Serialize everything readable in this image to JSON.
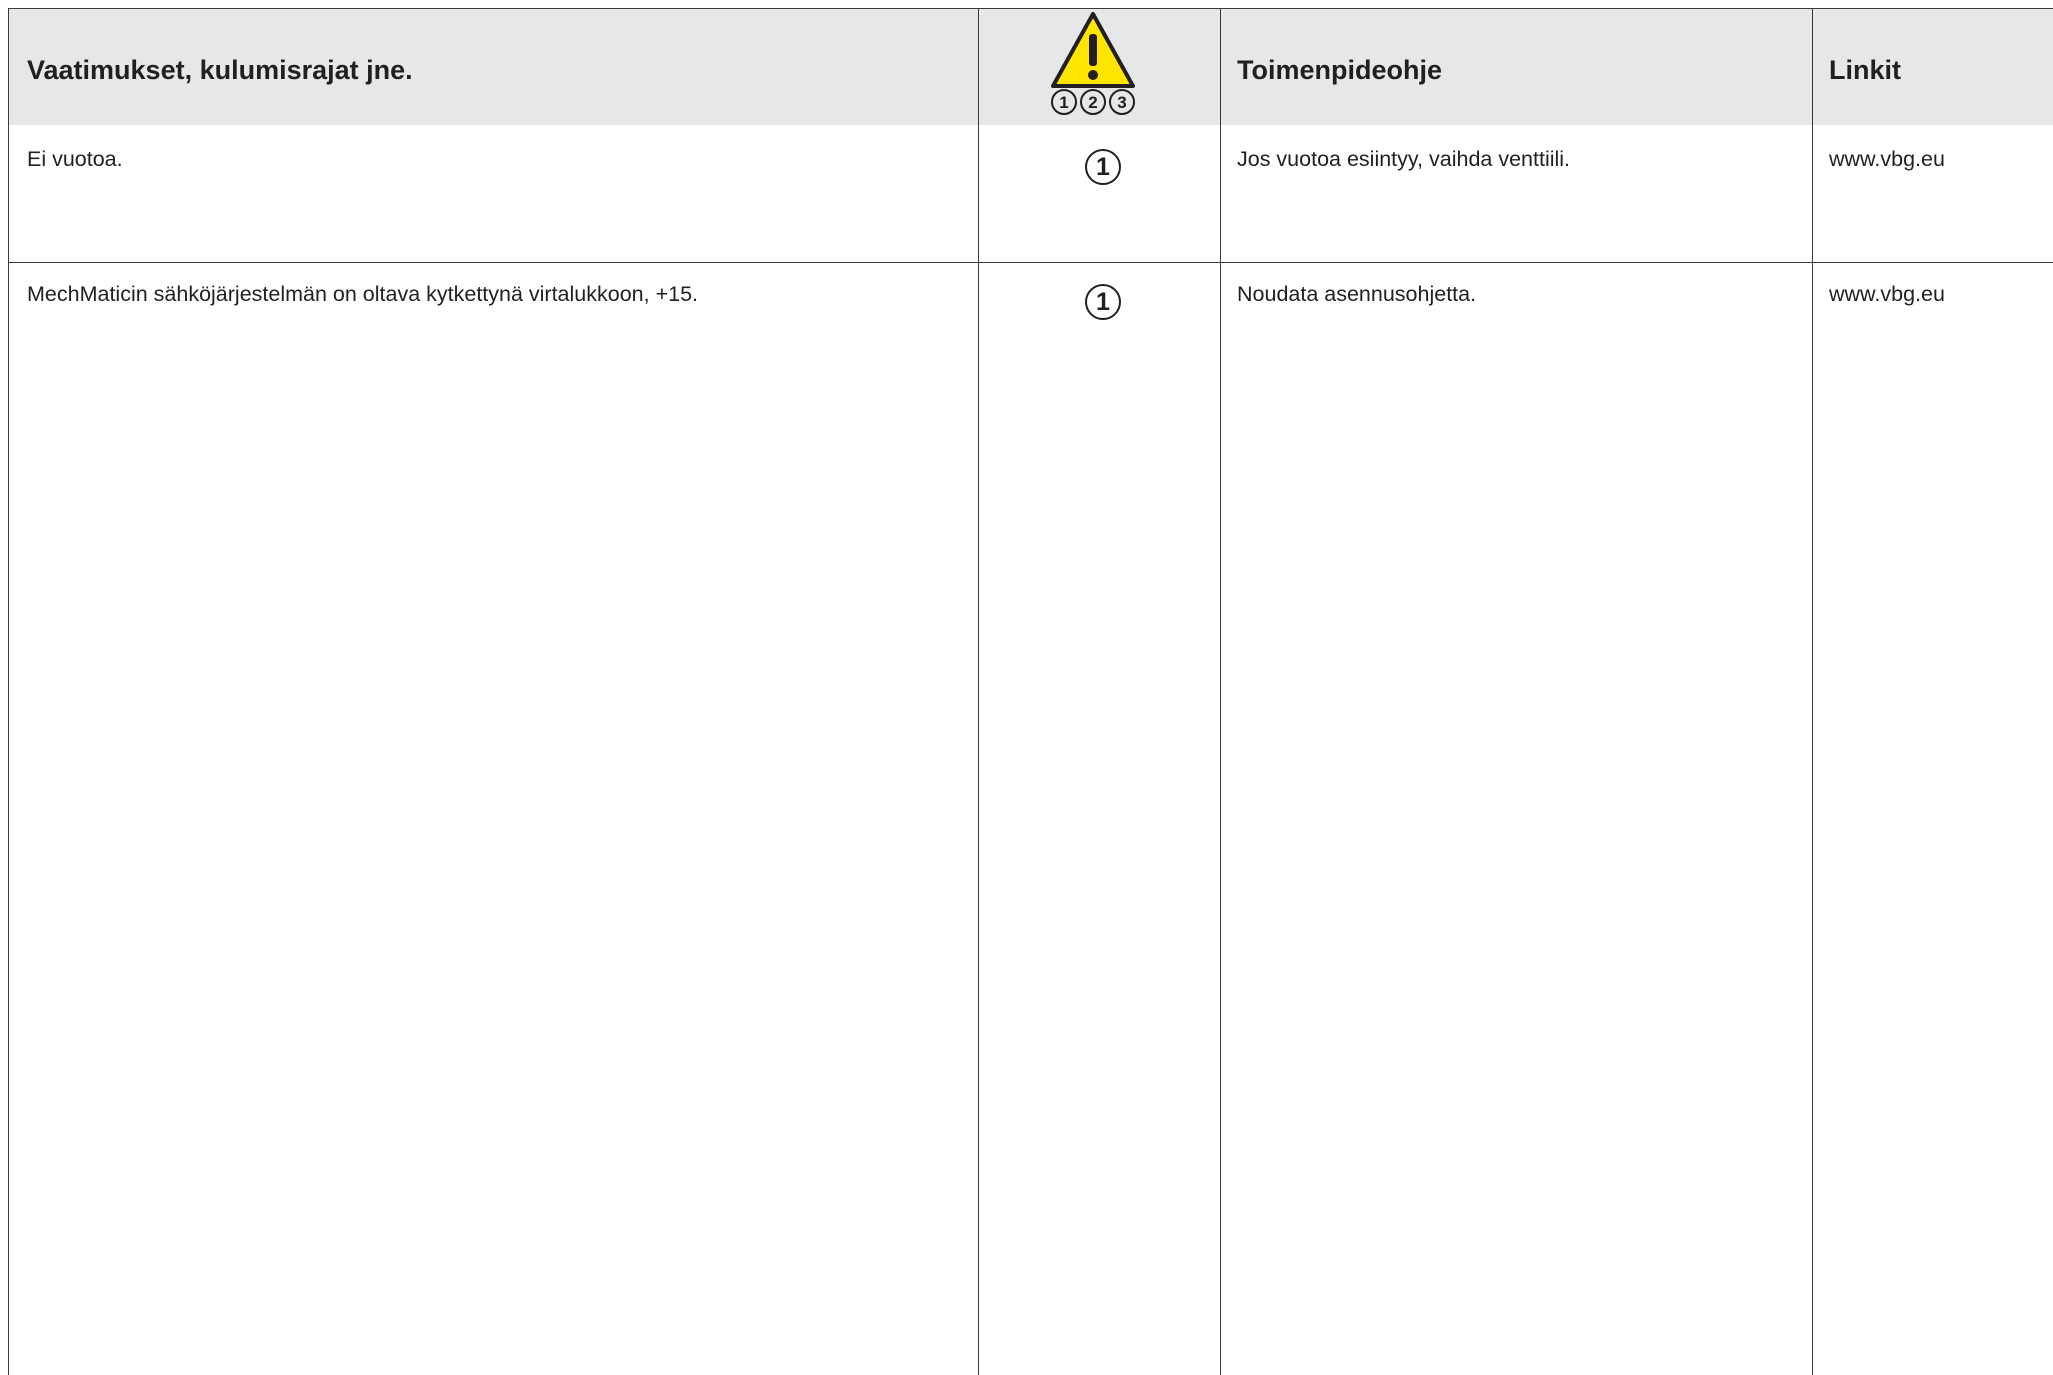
{
  "header": {
    "col_requirements": "Vaatimukset, kulumisrajat jne.",
    "col_warning_icon": "warning-triangle-icon",
    "col_warning_levels": [
      "1",
      "2",
      "3"
    ],
    "col_instructions": "Toimenpideohje",
    "col_links": "Linkit"
  },
  "rows": [
    {
      "requirement": "Ei vuotoa.",
      "level": "1",
      "instruction": "Jos vuotoa esiintyy, vaihda venttiili.",
      "link": "www.vbg.eu"
    },
    {
      "requirement": "MechMaticin sähköjärjestelmän on oltava kytkettynä virtalukkoon, +15.",
      "level": "1",
      "instruction": "Noudata asennusohjetta.",
      "link": "www.vbg.eu"
    }
  ],
  "colors": {
    "header_bg": "#e6e7e8",
    "warning_yellow": "#ffe600",
    "text": "#231f20"
  }
}
